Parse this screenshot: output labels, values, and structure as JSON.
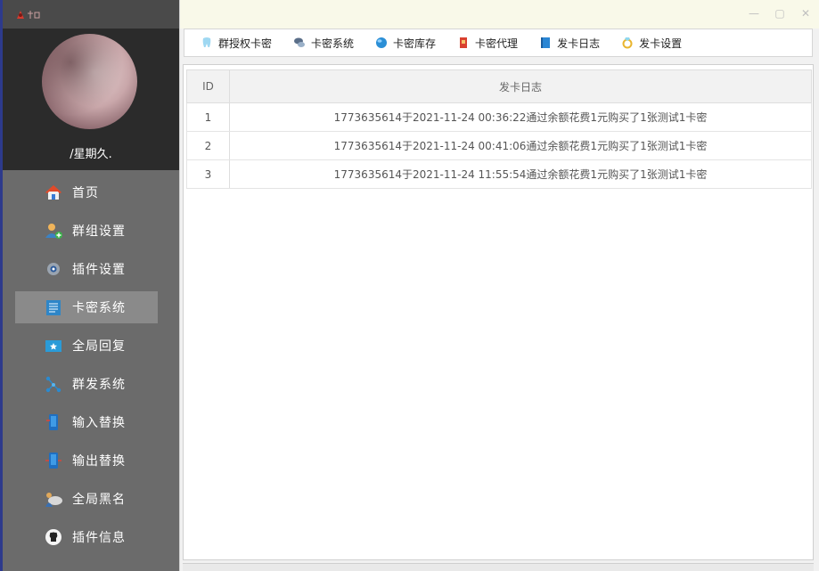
{
  "window": {
    "minimize": "—",
    "maximize": "▢",
    "close": "✕"
  },
  "profile": {
    "username": "/星期久."
  },
  "sidebar": {
    "items": [
      {
        "label": "首页",
        "icon": "home-icon",
        "active": false
      },
      {
        "label": "群组设置",
        "icon": "group-add-icon",
        "active": false
      },
      {
        "label": "插件设置",
        "icon": "gear-icon",
        "active": false
      },
      {
        "label": "卡密系统",
        "icon": "document-icon",
        "active": true
      },
      {
        "label": "全局回复",
        "icon": "star-mail-icon",
        "active": false
      },
      {
        "label": "群发系统",
        "icon": "share-nodes-icon",
        "active": false
      },
      {
        "label": "输入替换",
        "icon": "phone-input-icon",
        "active": false
      },
      {
        "label": "输出替换",
        "icon": "phone-output-icon",
        "active": false
      },
      {
        "label": "全局黑名",
        "icon": "cloud-user-icon",
        "active": false
      },
      {
        "label": "插件信息",
        "icon": "github-icon",
        "active": false
      }
    ]
  },
  "tabs": [
    {
      "label": "群授权卡密",
      "icon": "tooth-icon"
    },
    {
      "label": "卡密系统",
      "icon": "chat-bubbles-icon"
    },
    {
      "label": "卡密库存",
      "icon": "globe-icon"
    },
    {
      "label": "卡密代理",
      "icon": "red-card-icon"
    },
    {
      "label": "发卡日志",
      "icon": "blue-book-icon"
    },
    {
      "label": "发卡设置",
      "icon": "ring-icon"
    }
  ],
  "table": {
    "columns": [
      "ID",
      "发卡日志"
    ],
    "rows": [
      {
        "id": "1",
        "log": "1773635614于2021-11-24  00:36:22通过余额花费1元购买了1张测试1卡密"
      },
      {
        "id": "2",
        "log": "1773635614于2021-11-24  00:41:06通过余额花费1元购买了1张测试1卡密"
      },
      {
        "id": "3",
        "log": "1773635614于2021-11-24  11:55:54通过余额花费1元购买了1张测试1卡密"
      }
    ]
  },
  "colors": {
    "sidebar_bg": "#6b6b6b",
    "profile_bg": "#2b2b2b",
    "active_item": "#8a8a8a",
    "titlebar_bg": "#f9f9e9"
  }
}
